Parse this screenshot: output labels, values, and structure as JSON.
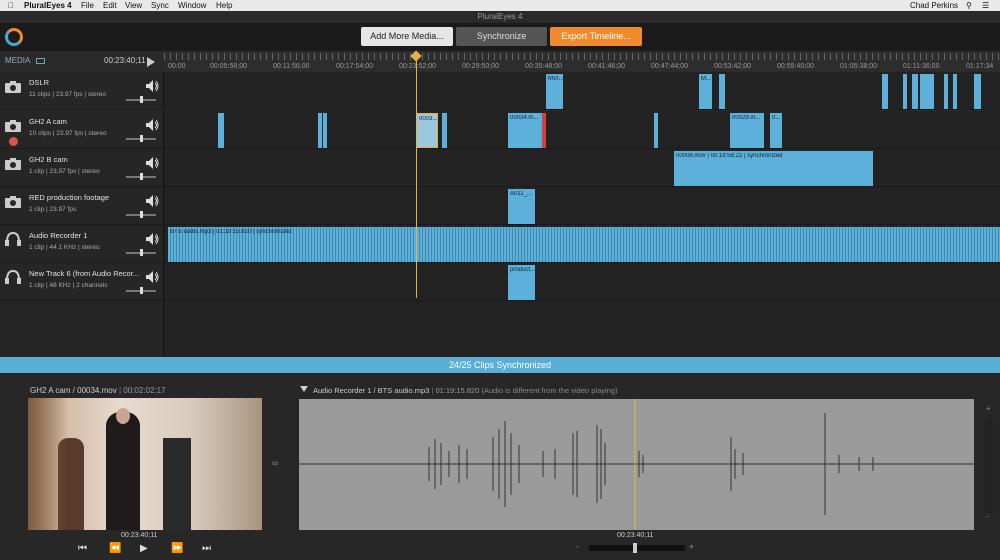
{
  "menubar": {
    "app_name": "PluralEyes 4",
    "menus": [
      "File",
      "Edit",
      "View",
      "Sync",
      "Window",
      "Help"
    ],
    "user": "Chad Perkins"
  },
  "window": {
    "title": "PluralEyes 4"
  },
  "toolbar": {
    "add_media_label": "Add More Media...",
    "synchronize_label": "Synchronize",
    "export_label": "Export Timeline...",
    "accent_orange": "#f08a2c"
  },
  "media_header": {
    "label": "MEDIA",
    "timecode": "00:23:40;11"
  },
  "ruler": {
    "ticks": [
      "00:00",
      "00:05:58;00",
      "00:11:56;00",
      "00:17:54;00",
      "00:23:52;00",
      "00:29:50;00",
      "00:35:48;00",
      "00:41:46;00",
      "00:47:44;00",
      "00:53:42;00",
      "00:59:40;00",
      "01:05:38;00",
      "01:11:36;00",
      "01:17:34"
    ]
  },
  "tracks": [
    {
      "name": "DSLR",
      "meta": "11 clips  |  23.97 fps  |  stereo",
      "icon": "camera-icon"
    },
    {
      "name": "GH2 A cam",
      "meta": "10 clips  |  23.97 fps  |  stereo",
      "icon": "camera-icon"
    },
    {
      "name": "GH2 B cam",
      "meta": "1 clip  |  23.97 fps  |  stereo",
      "icon": "camera-icon"
    },
    {
      "name": "RED production footage",
      "meta": "1 clip  |  23.97 fps",
      "icon": "camera-icon"
    },
    {
      "name": "Audio Recorder 1",
      "meta": "1 clip  |  44.1 KHz  |  stereo",
      "icon": "headphones-icon"
    },
    {
      "name": "New Track 6 (from Audio Recor...",
      "meta": "1 clip  |  48 KHz  |  2 channels",
      "icon": "headphones-icon"
    }
  ],
  "clip_labels": {
    "dslr_a": "MVI...",
    "dslr_b": "M...",
    "gh2a_a": "0003...",
    "gh2a_b": "00034.m...",
    "gh2a_c": "00029.m...",
    "gh2a_d": "0...",
    "gh2b": "00008.mov  |  00:18:58;22  |  synchronized",
    "red": "A011_...",
    "audio1": "BTS audio.mp3  |  01:19:15.820  |  synchronized",
    "track6": "product..."
  },
  "status": {
    "text": "24/25 Clips Synchronized"
  },
  "viewer": {
    "video_label": "GH2 A cam / 00034.mov",
    "video_time": "00:02:02;17",
    "audio_label": "Audio Recorder 1 / BTS audio.mp3",
    "audio_time": "01:19:15.820",
    "audio_note": "(Audio is different from the video playing)",
    "video_timecode": "00:23:40;11",
    "audio_timecode": "00:23:40;11"
  },
  "colors": {
    "clip_blue": "#5cb0da",
    "playhead": "#e8b040",
    "status_bar": "#5aaed6"
  }
}
